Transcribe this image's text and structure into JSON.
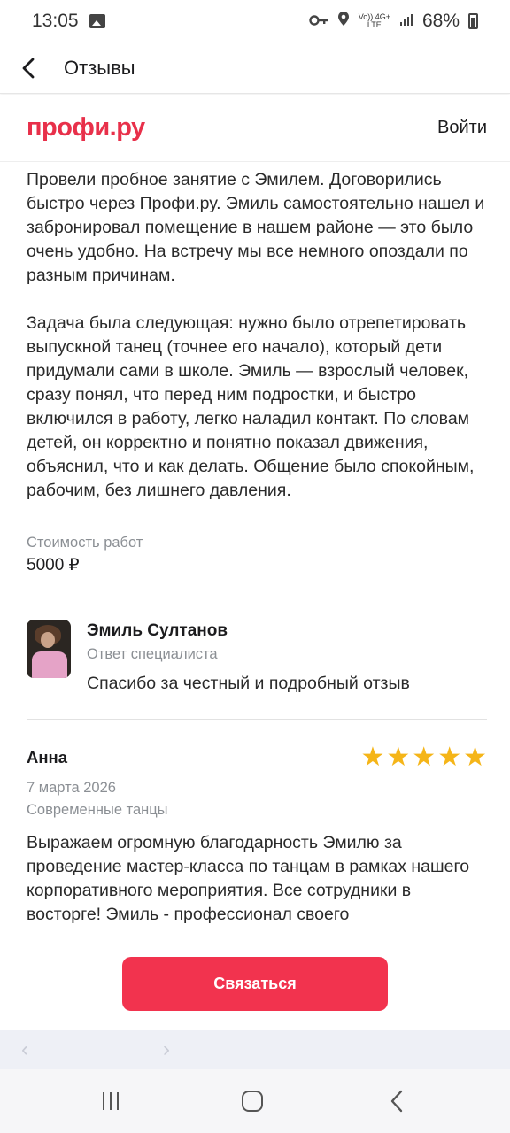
{
  "status_bar": {
    "time": "13:05",
    "net_top": "Vo)) 4G+",
    "net_bottom": "LTE",
    "battery": "68%"
  },
  "header": {
    "title": "Отзывы"
  },
  "site": {
    "logo": "профи.ру",
    "login": "Войти"
  },
  "review": {
    "paragraphs": [
      "Провели пробное занятие с Эмилем. Договорились быстро через Профи.ру. Эмиль самостоятельно нашел и забронировал помещение в нашем районе — это было очень удобно. На встречу мы все немного опоздали по разным причинам.",
      "Задача была следующая: нужно было отрепетировать выпускной танец (точнее его начало), который дети придумали сами в школе. Эмиль — взрослый человек, сразу понял, что перед ним подростки, и быстро включился в работу, легко наладил контакт. По словам детей, он корректно и понятно показал движения, объяснил, что и как делать. Общение было спокойным, рабочим, без лишнего давления."
    ],
    "cost_label": "Стоимость работ",
    "cost_value": "5000 ₽"
  },
  "reply": {
    "name": "Эмиль Султанов",
    "role": "Ответ специалиста",
    "text": "Спасибо за честный и подробный отзыв"
  },
  "review2": {
    "author": "Анна",
    "rating": 5,
    "date": "7 марта 2026",
    "category": "Современные танцы",
    "text": "Выражаем огромную благодарность Эмилю за проведение мастер-класса по танцам в рамках нашего корпоративного мероприятия. Все сотрудники в восторге! Эмиль - профессионал своего"
  },
  "cta": {
    "label": "Связаться"
  },
  "colors": {
    "brand": "#e8304a",
    "button": "#f2334e",
    "star": "#f5b518",
    "muted": "#8b8f94"
  },
  "icons": {
    "back": "chevron-left-icon",
    "gallery": "gallery-icon",
    "key": "key-icon",
    "location": "location-icon",
    "signal": "signal-icon",
    "battery": "battery-icon",
    "star": "star-icon"
  }
}
